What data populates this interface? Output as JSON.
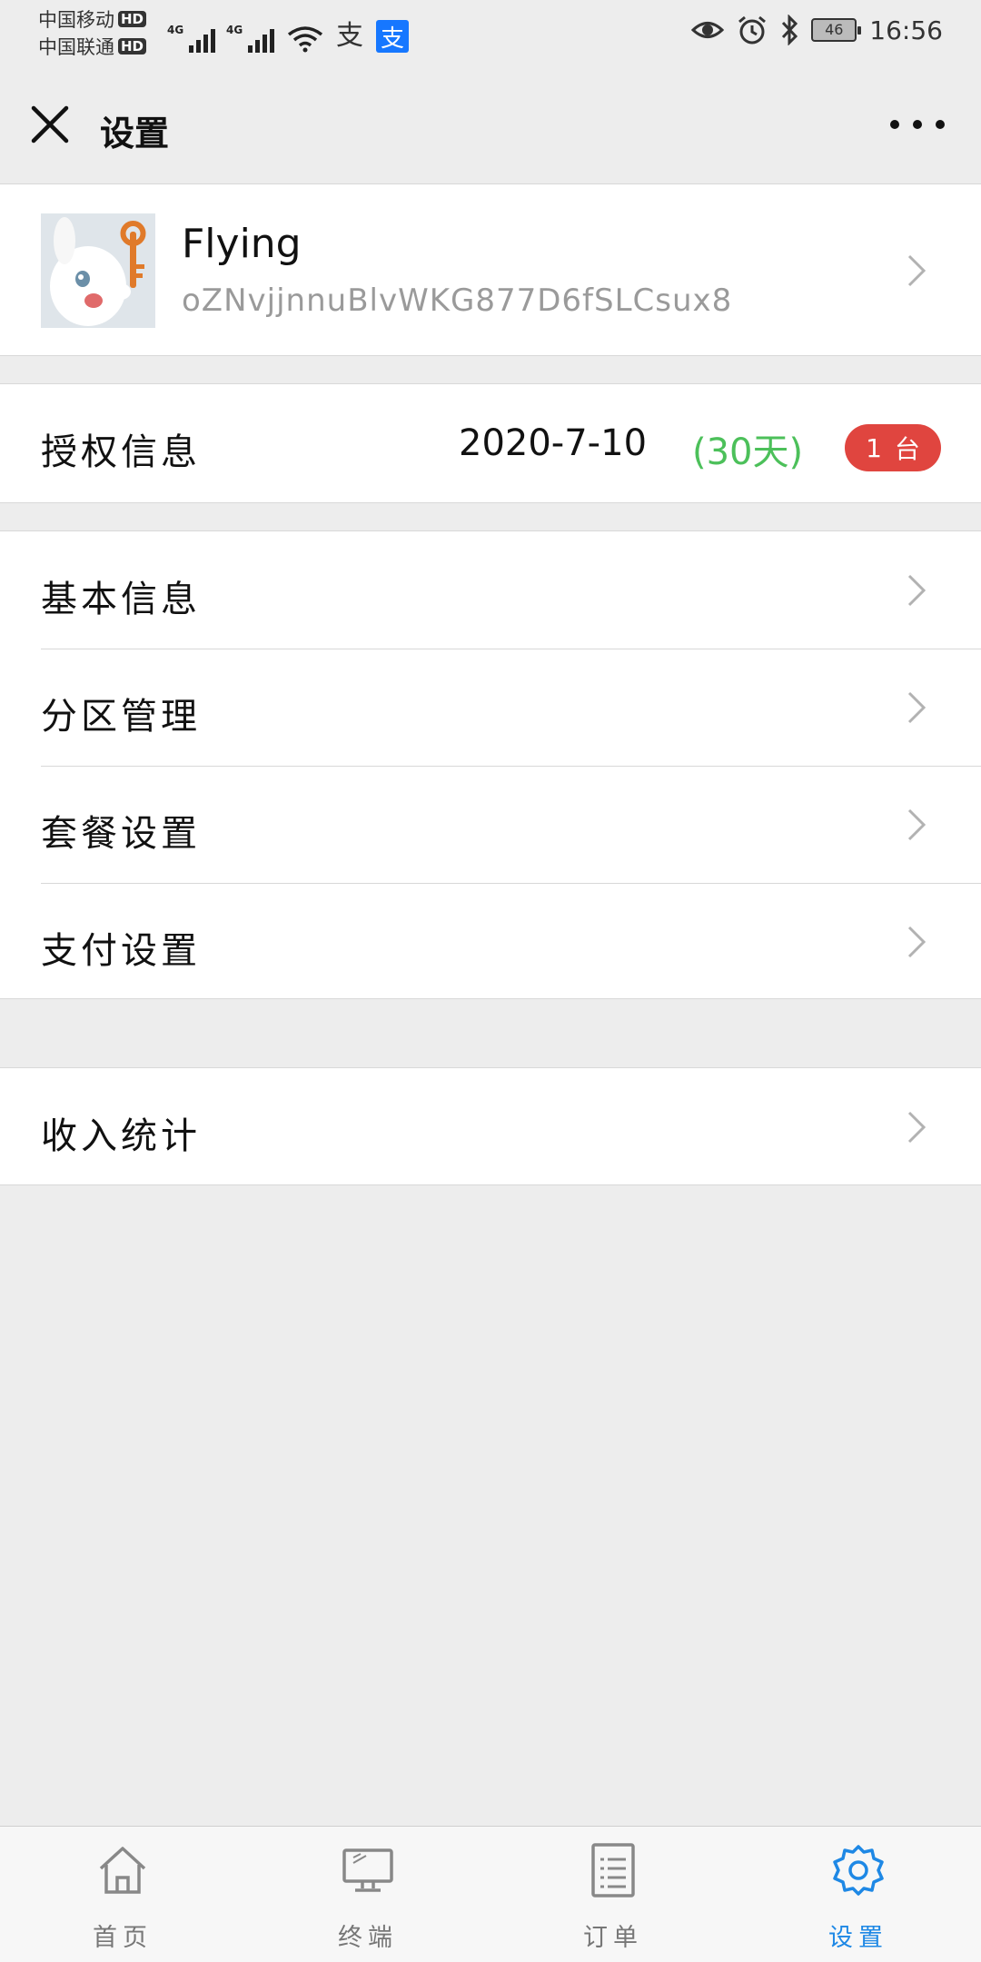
{
  "status_bar": {
    "carrier1": "中国移动",
    "carrier2": "中国联通",
    "hd_badge": "HD",
    "network": "4G",
    "alipay_icon": "支",
    "battery": "46",
    "time": "16:56"
  },
  "nav": {
    "title": "设置"
  },
  "profile": {
    "name": "Flying",
    "id": "oZNvjjnnuBlvWKG877D6fSLCsux8"
  },
  "license": {
    "label": "授权信息",
    "expiry": "2020-7-10",
    "days_remaining": "(30天)",
    "device_count": "1",
    "device_unit": "台"
  },
  "menu": {
    "items": [
      {
        "label": "基本信息"
      },
      {
        "label": "分区管理"
      },
      {
        "label": "套餐设置"
      },
      {
        "label": "支付设置"
      }
    ]
  },
  "income": {
    "label": "收入统计"
  },
  "tabbar": {
    "tabs": [
      {
        "label": "首页",
        "icon": "home-icon"
      },
      {
        "label": "终端",
        "icon": "monitor-icon"
      },
      {
        "label": "订单",
        "icon": "order-list-icon"
      },
      {
        "label": "设置",
        "icon": "gear-icon",
        "active": true
      }
    ]
  },
  "colors": {
    "accent": "#1E88E5",
    "days_green": "#4CC05A",
    "badge_red": "#E0453F",
    "background": "#EDEDED"
  }
}
